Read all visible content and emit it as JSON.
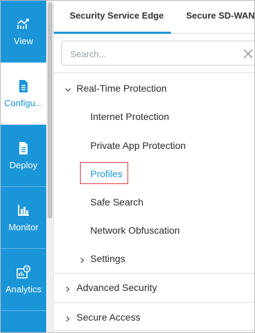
{
  "rail": {
    "items": [
      {
        "label": "View",
        "icon": "chart-line-icon"
      },
      {
        "label": "Configu...",
        "icon": "document-icon"
      },
      {
        "label": "Deploy",
        "icon": "document-icon"
      },
      {
        "label": "Monitor",
        "icon": "bar-chart-icon"
      },
      {
        "label": "Analytics",
        "icon": "analytics-clock-icon"
      }
    ],
    "active": "Configu..."
  },
  "tabs": [
    {
      "label": "Security Service Edge",
      "active": true
    },
    {
      "label": "Secure SD-WAN",
      "active": false
    }
  ],
  "search": {
    "placeholder": "Search...",
    "value": ""
  },
  "tree": {
    "realtime": {
      "label": "Real-Time Protection",
      "expanded": true
    },
    "children": [
      {
        "label": "Internet Protection"
      },
      {
        "label": "Private App Protection"
      },
      {
        "label": "Profiles",
        "highlighted": true
      },
      {
        "label": "Safe Search"
      },
      {
        "label": "Network Obfuscation"
      },
      {
        "label": "Settings",
        "collapsed": true
      }
    ],
    "advanced": {
      "label": "Advanced Security"
    },
    "secure_access": {
      "label": "Secure Access"
    }
  },
  "colors": {
    "accent": "#1a95d8",
    "highlight_box": "#e0373b"
  }
}
